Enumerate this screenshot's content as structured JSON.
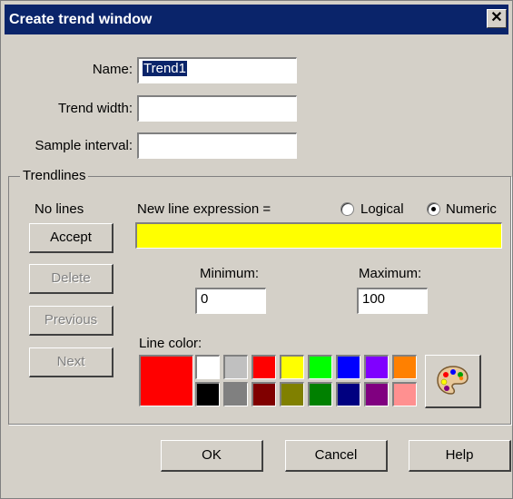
{
  "window": {
    "title": "Create trend window",
    "close_glyph": "✕"
  },
  "form": {
    "name_label": "Name:",
    "name_value": "Trend1",
    "width_label": "Trend width:",
    "width_value": "",
    "interval_label": "Sample interval:",
    "interval_value": ""
  },
  "trendlines": {
    "group_label": "Trendlines",
    "status": "No lines",
    "expression_label": "New line expression =",
    "expression_value": "",
    "radio_logical": "Logical",
    "radio_numeric": "Numeric",
    "selected_type": "Numeric",
    "accept": "Accept",
    "delete": "Delete",
    "previous": "Previous",
    "next": "Next",
    "minimum_label": "Minimum:",
    "minimum_value": "0",
    "maximum_label": "Maximum:",
    "maximum_value": "100",
    "line_color_label": "Line color:",
    "selected_color": "#ff0000",
    "palette_icon": "palette-icon",
    "colors": [
      "#ffffff",
      "#c0c0c0",
      "#ff0000",
      "#ffff00",
      "#00ff00",
      "#0000ff",
      "#8000ff",
      "#ff8000",
      "#000000",
      "#808080",
      "#800000",
      "#808000",
      "#008000",
      "#000080",
      "#800080",
      "#ff9090"
    ]
  },
  "buttons": {
    "ok": "OK",
    "cancel": "Cancel",
    "help": "Help"
  },
  "theme": {
    "titlebar": "#0a246a",
    "dialog_bg": "#d4d0c8",
    "expression_bg": "#ffff00"
  }
}
